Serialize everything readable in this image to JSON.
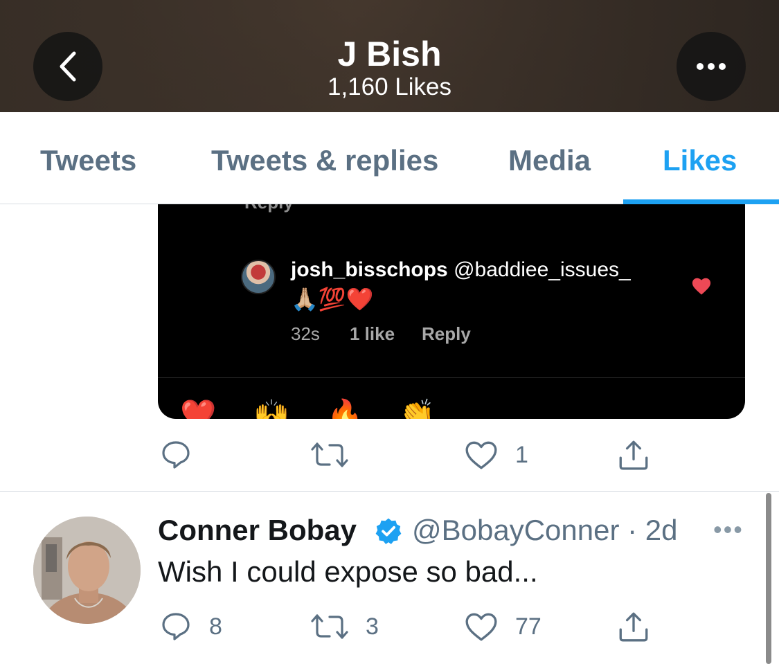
{
  "header": {
    "title": "J Bish",
    "subtitle": "1,160 Likes"
  },
  "tabs": [
    {
      "label": "Tweets",
      "active": false
    },
    {
      "label": "Tweets & replies",
      "active": false
    },
    {
      "label": "Media",
      "active": false
    },
    {
      "label": "Likes",
      "active": true
    }
  ],
  "colors": {
    "accent": "#1da1f2",
    "secondary_text": "#5b7083",
    "primary_text": "#14171a"
  },
  "embedded_media": {
    "cut_off_text": "Reply",
    "comment": {
      "username": "josh_bisschops",
      "mention": "@baddiee_issues_",
      "emojis": "🙏🏼💯❤️",
      "time": "32s",
      "likes": "1 like",
      "reply_label": "Reply"
    },
    "reactions": [
      "❤️",
      "🙌",
      "🔥",
      "👏",
      "😢",
      "😍",
      "😮",
      "😂"
    ]
  },
  "tweet1_actions": {
    "reply_count": "",
    "retweet_count": "",
    "like_count": "1"
  },
  "tweet2": {
    "name": "Conner Bobay",
    "handle_time": "@BobayConner · 2d",
    "text": "Wish I could expose so bad...",
    "more": "•••",
    "reply_count": "8",
    "retweet_count": "3",
    "like_count": "77"
  }
}
